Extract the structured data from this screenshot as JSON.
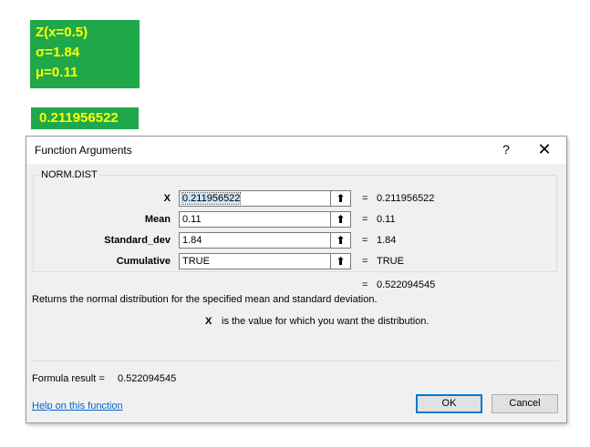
{
  "sheet": {
    "param_lines": [
      "Z(x=0.5)",
      "σ=1.84",
      "μ=0.11"
    ],
    "result_cell": "0.211956522",
    "colors": {
      "cell_fill": "#1fa84a",
      "cell_text": "#ffff00"
    }
  },
  "dialog": {
    "title": "Function Arguments",
    "help_glyph": "?",
    "close_glyph": "✕",
    "function_name": "NORM.DIST",
    "args": [
      {
        "label": "X",
        "value": "0.211956522",
        "result": "0.211956522"
      },
      {
        "label": "Mean",
        "value": "0.11",
        "result": "0.11"
      },
      {
        "label": "Standard_dev",
        "value": "1.84",
        "result": "1.84"
      },
      {
        "label": "Cumulative",
        "value": "TRUE",
        "result": "TRUE"
      }
    ],
    "equals": "=",
    "overall_result": "0.522094545",
    "description": "Returns the normal distribution for the specified mean and standard deviation.",
    "arg_desc_name": "X",
    "arg_desc_text": "is the value for which you want the distribution.",
    "formula_result_label": "Formula result =",
    "formula_result_value": "0.522094545",
    "help_link": "Help on this function",
    "ok_label": "OK",
    "cancel_label": "Cancel",
    "ref_icon": "collapse-dialog-icon"
  }
}
